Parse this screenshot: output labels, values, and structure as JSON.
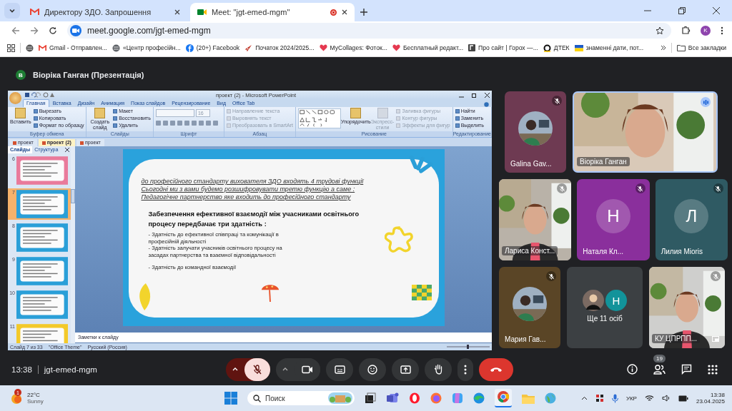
{
  "browser": {
    "tabs": [
      {
        "title": "Директору ЗДО. Запрошення",
        "selected": false,
        "recording": false
      },
      {
        "title": "Meet: \"jgt-emed-mgm\"",
        "selected": true,
        "recording": true
      }
    ],
    "address": "meet.google.com/jgt-emed-mgm",
    "profile_letter": "K",
    "bookmarks": [
      "Gmail - Отправлен...",
      "«Центр професійн...",
      "(20+) Facebook",
      "Початок 2024/2025...",
      "MyCollages: Фоток...",
      "Бесплатный редакт...",
      "Про сайт | Горох —...",
      "ДТЕК",
      "знаменні дати, пот..."
    ],
    "all_bookmarks": "Все закладки"
  },
  "meet": {
    "presenter": {
      "letter": "В",
      "title": "Віоріка Ганган (Презентація)"
    },
    "powerpoint": {
      "title": "проект (2) - Microsoft PowerPoint",
      "ribbon_tabs": [
        {
          "label": "Главная",
          "selected": true
        },
        {
          "label": "Вставка",
          "selected": false
        },
        {
          "label": "Дизайн",
          "selected": false
        },
        {
          "label": "Анимация",
          "selected": false
        },
        {
          "label": "Показ слайдов",
          "selected": false
        },
        {
          "label": "Рецензирование",
          "selected": false
        },
        {
          "label": "Вид",
          "selected": false
        },
        {
          "label": "Office Tab",
          "selected": false
        }
      ],
      "groups": [
        {
          "label": "Буфер обмена",
          "kind": "standard",
          "items": [
            {
              "label": "Вставить",
              "kind": "large",
              "disabled": false
            },
            {
              "label": "Вырезать",
              "kind": "small",
              "disabled": false
            },
            {
              "label": "Копировать",
              "kind": "small",
              "disabled": false
            },
            {
              "label": "Формат по образцу",
              "kind": "small",
              "disabled": false
            }
          ]
        },
        {
          "label": "Слайды",
          "kind": "standard",
          "items": [
            {
              "label": "Создать слайд",
              "kind": "large",
              "disabled": false
            },
            {
              "label": "Макет",
              "kind": "small",
              "disabled": false
            },
            {
              "label": "Восстановить",
              "kind": "small",
              "disabled": false
            },
            {
              "label": "Удалить",
              "kind": "small",
              "disabled": false
            }
          ]
        },
        {
          "label": "Шрифт",
          "kind": "font",
          "font_size": "16"
        },
        {
          "label": "Абзац",
          "kind": "standard",
          "items": [
            {
              "label": "Направление текста",
              "kind": "small",
              "disabled": true
            },
            {
              "label": "Выровнять текст",
              "kind": "small",
              "disabled": true
            },
            {
              "label": "Преобразовать в SmartArt",
              "kind": "small",
              "disabled": true
            }
          ]
        },
        {
          "label": "Рисование",
          "kind": "shapes",
          "items": [
            {
              "label": "Упорядочить",
              "kind": "large",
              "disabled": false
            },
            {
              "label": "Экспресс-стили",
              "kind": "large",
              "disabled": true
            },
            {
              "label": "Заливка фигуры",
              "kind": "small",
              "disabled": true
            },
            {
              "label": "Контур фигуры",
              "kind": "small",
              "disabled": true
            },
            {
              "label": "Эффекты для фигур",
              "kind": "small",
              "disabled": true
            }
          ]
        },
        {
          "label": "Редактирование",
          "kind": "standard",
          "items": [
            {
              "label": "Найти",
              "kind": "small",
              "disabled": false
            },
            {
              "label": "Заменить",
              "kind": "small",
              "disabled": false
            },
            {
              "label": "Выделить",
              "kind": "small",
              "disabled": false
            }
          ]
        }
      ],
      "doc_tabs": [
        {
          "label": "проект",
          "selected": false
        },
        {
          "label": "проект (2)",
          "selected": true
        },
        {
          "label": "проект",
          "selected": false
        }
      ],
      "pane_tabs": [
        {
          "label": "Слайды",
          "selected": true
        },
        {
          "label": "Структура",
          "selected": false
        }
      ],
      "slides": [
        {
          "number": "6",
          "selected": false,
          "color": "#e97a9b"
        },
        {
          "number": "7",
          "selected": true,
          "color": "#2a9fd8"
        },
        {
          "number": "8",
          "selected": false,
          "color": "#2a9fd8"
        },
        {
          "number": "9",
          "selected": false,
          "color": "#2a9fd8"
        },
        {
          "number": "10",
          "selected": false,
          "color": "#2a9fd8"
        },
        {
          "number": "11",
          "selected": false,
          "color": "#f3c92a"
        }
      ],
      "slide": {
        "intro": [
          "до  професійного стандарту вихователя ЗДО входять 4 трудові функції",
          "Сьогодні  ми з вами будемо розшифровувати  третю функцію  а саме :",
          "Педагогічне партнерство  яке входить до професійного стандарту"
        ],
        "heading": "Забезпечення ефективної взаємодії між учасниками освітнього процесу передбачає три здатність :",
        "bullets": [
          "- Здатність до ефективної співпраці та комунікації в професійній діяльності",
          "- Здатність залучати учасників освітнього процесу на засадах партнерства та взаємної відповідальності",
          "- Здатність до командної взаємодії"
        ]
      },
      "notes": "Заметки к слайду",
      "status": [
        "Слайд 7 из 33",
        "\"Office Theme\"",
        "Русский (Россия)"
      ]
    },
    "tiles": [
      {
        "name": "Galina Gav...",
        "muted": true,
        "speaking": false,
        "color": "#6e3a52"
      },
      {
        "name": "Віоріка Ганган",
        "kind": "video",
        "muted": false,
        "speaking": true,
        "color": "#d9c9b8"
      },
      {
        "name": "Лариса Конст...",
        "kind": "video",
        "muted": true,
        "speaking": false,
        "color": "#b9b2a8"
      },
      {
        "name": "Наталя Кл...",
        "kind": "letter",
        "letter": "Н",
        "muted": true,
        "speaking": false,
        "color": "#8a2f9c"
      },
      {
        "name": "Лилия Mioris",
        "kind": "letter",
        "letter": "Л",
        "muted": true,
        "speaking": false,
        "color": "#2f5a63"
      },
      {
        "name": "Мария Гав...",
        "muted": true,
        "speaking": false,
        "color": "#5a4526"
      },
      {
        "name": "Ще 11 осіб",
        "kind": "others",
        "letter": "Н",
        "muted": false,
        "speaking": false,
        "color": "#3c4043"
      },
      {
        "name": "КУ ЦПРПП...",
        "kind": "video",
        "muted": true,
        "speaking": false,
        "color": "#cfcfcd"
      }
    ],
    "bottom": {
      "time": "13:38",
      "code": "jgt-emed-mgm",
      "people_count": "19",
      "mic_on": false
    }
  },
  "taskbar": {
    "temperature": "22°C",
    "weather": "Sunny",
    "weather_badge": "1",
    "search_placeholder": "Поиск",
    "language": "УКР",
    "time": "13:38",
    "date": "23.04.2025"
  }
}
